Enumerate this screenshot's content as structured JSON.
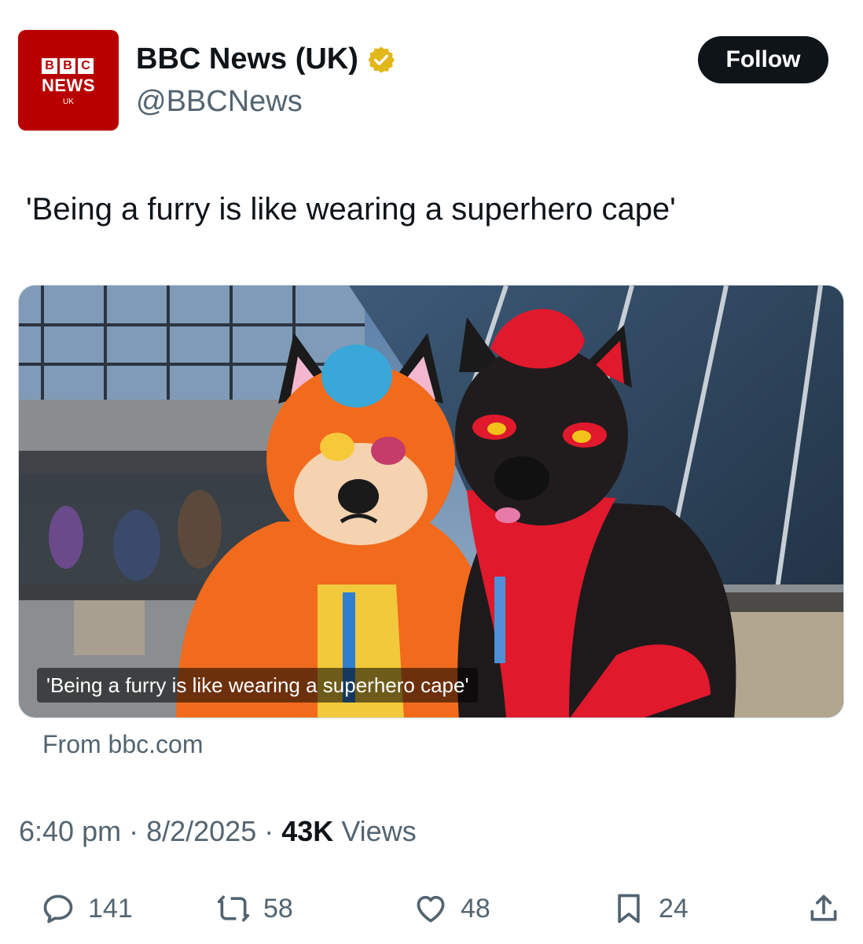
{
  "author": {
    "avatar": {
      "block_letters": [
        "B",
        "B",
        "C"
      ],
      "news": "NEWS",
      "region": "UK"
    },
    "display_name": "BBC News (UK)",
    "verified_icon": "verified-badge-icon",
    "handle": "@BBCNews",
    "follow_label": "Follow"
  },
  "tweet": {
    "text": "'Being a furry is like wearing a superhero cape'"
  },
  "link_card": {
    "image_caption": "'Being a furry is like wearing a superhero cape'",
    "source": "From bbc.com"
  },
  "meta": {
    "time": "6:40 pm",
    "date": "8/2/2025",
    "views_count": "43K",
    "views_label": "Views"
  },
  "actions": {
    "replies": {
      "icon": "reply-icon",
      "count": "141"
    },
    "retweets": {
      "icon": "retweet-icon",
      "count": "58"
    },
    "likes": {
      "icon": "heart-icon",
      "count": "48"
    },
    "bookmarks": {
      "icon": "bookmark-icon",
      "count": "24"
    },
    "share": {
      "icon": "share-icon"
    }
  },
  "colors": {
    "bbc_red": "#b80000",
    "verified_gold": "#e2b719",
    "text_primary": "#0f1419",
    "text_secondary": "#536471"
  }
}
